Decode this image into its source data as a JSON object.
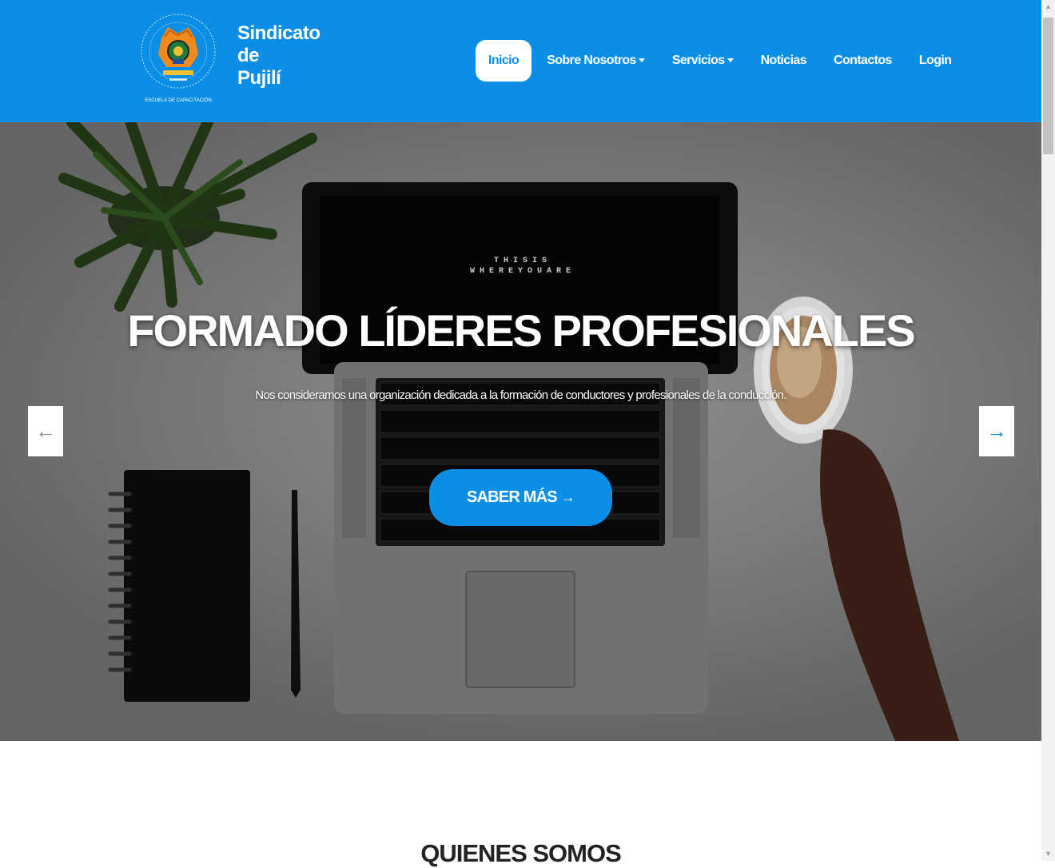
{
  "brand": {
    "line1": "Sindicato",
    "line2": "de",
    "line3": "Pujilí",
    "logo_text": "ESCUELA DE CAPACITACIÓN"
  },
  "nav": {
    "items": [
      {
        "label": "Inicio"
      },
      {
        "label": "Sobre Nosotros"
      },
      {
        "label": "Servicios"
      },
      {
        "label": "Noticias"
      },
      {
        "label": "Contactos"
      },
      {
        "label": "Login"
      }
    ]
  },
  "hero": {
    "title": "FORMADO LÍDERES PROFESIONALES",
    "subtitle": "Nos consideramos una organización dedicada a la formación de conductores y profesionales de la conducción.",
    "button_label": "SABER MÁS",
    "button_icon": "→",
    "prev_icon": "←",
    "next_icon": "→",
    "laptop_screen_line1": "T H I S   I S",
    "laptop_screen_line2": "W H E R E   Y O U   A R E"
  },
  "section": {
    "title": "QUIENES SOMOS"
  },
  "colors": {
    "brand_blue": "#0b8fe6",
    "white": "#ffffff"
  }
}
